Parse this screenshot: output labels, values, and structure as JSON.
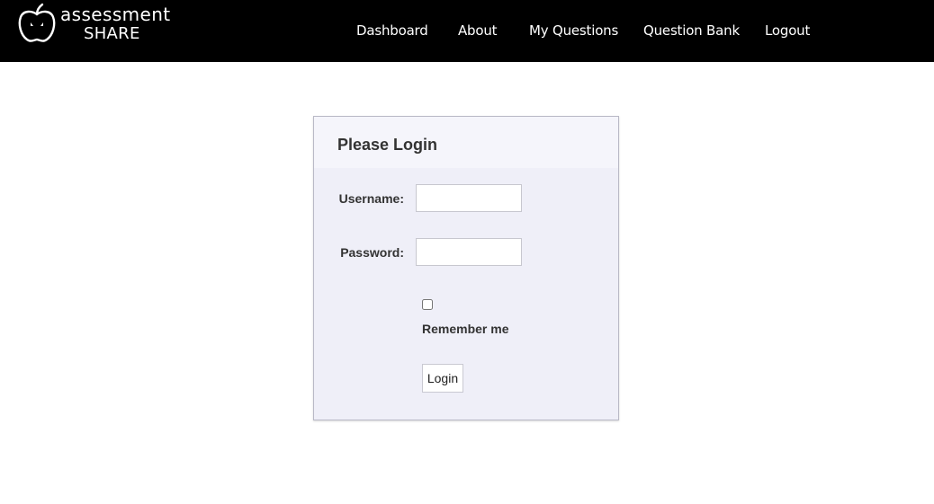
{
  "header": {
    "logo": {
      "line1": "assessment",
      "line2": "SHARE",
      "icon": "apple-logo-icon"
    },
    "nav": [
      {
        "label": "Dashboard"
      },
      {
        "label": "About"
      },
      {
        "label": "My Questions"
      },
      {
        "label": "Question Bank"
      },
      {
        "label": "Logout"
      }
    ]
  },
  "login": {
    "title": "Please Login",
    "username_label": "Username:",
    "username_value": "",
    "password_label": "Password:",
    "password_value": "",
    "remember_label": "Remember me",
    "remember_checked": false,
    "submit_label": "Login"
  },
  "colors": {
    "header_bg": "#000000",
    "panel_bg": "#efeff8",
    "panel_head_bg": "#f5f5fb",
    "text": "#333333"
  }
}
